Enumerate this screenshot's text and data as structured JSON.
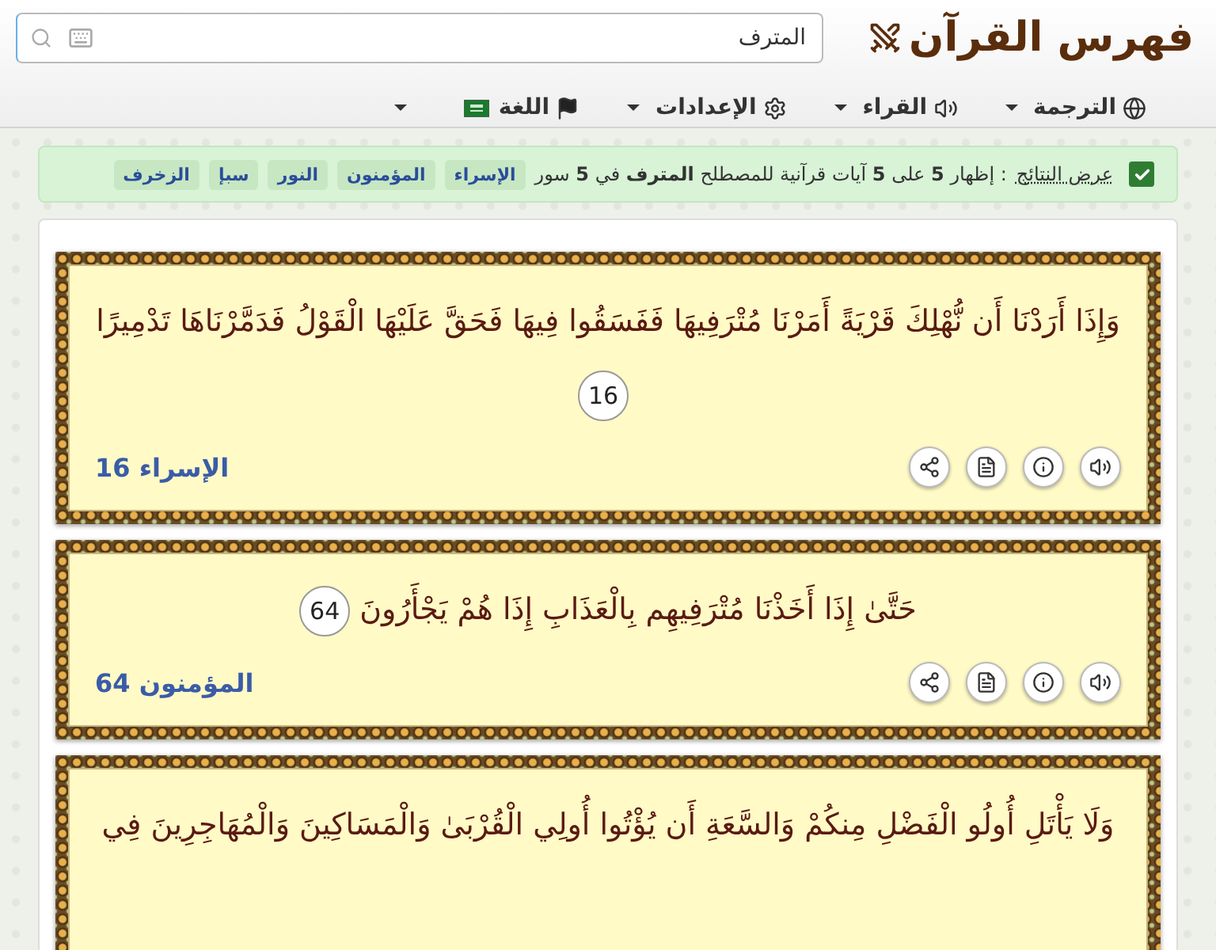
{
  "header": {
    "logo": "فهرس القرآن",
    "search": {
      "value": "المترف"
    }
  },
  "nav": [
    {
      "label": "الترجمة",
      "kind": "globe"
    },
    {
      "label": "القراء",
      "kind": "speaker"
    },
    {
      "label": "الإعدادات",
      "kind": "gear"
    },
    {
      "label": "اللغة",
      "kind": "flag"
    }
  ],
  "results": {
    "checked": true,
    "label": "عرض النتائج",
    "summary": ": إظهار **5** على **5** آيات قرآنية للمصطلح **المترف** في **5** سور",
    "tags": [
      "الإسراء",
      "المؤمنون",
      "النور",
      "سبإ",
      "الزخرف"
    ]
  },
  "verses": [
    {
      "text": "وَإِذَا أَرَدْنَا أَن نُّهْلِكَ قَرْيَةً أَمَرْنَا مُتْرَفِيهَا فَفَسَقُوا فِيهَا فَحَقَّ عَلَيْهَا الْقَوْلُ فَدَمَّرْنَاهَا تَدْمِيرًا",
      "number": "16",
      "reference": "الإسراء 16"
    },
    {
      "text": "حَتَّىٰ إِذَا أَخَذْنَا مُتْرَفِيهِم بِالْعَذَابِ إِذَا هُمْ يَجْأَرُونَ",
      "number": "64",
      "reference": "المؤمنون 64"
    },
    {
      "text": "وَلَا يَأْتَلِ أُولُو الْفَضْلِ مِنكُمْ وَالسَّعَةِ أَن يُؤْتُوا أُولِي الْقُرْبَىٰ وَالْمَسَاكِينَ وَالْمُهَاجِرِينَ فِي"
    }
  ]
}
